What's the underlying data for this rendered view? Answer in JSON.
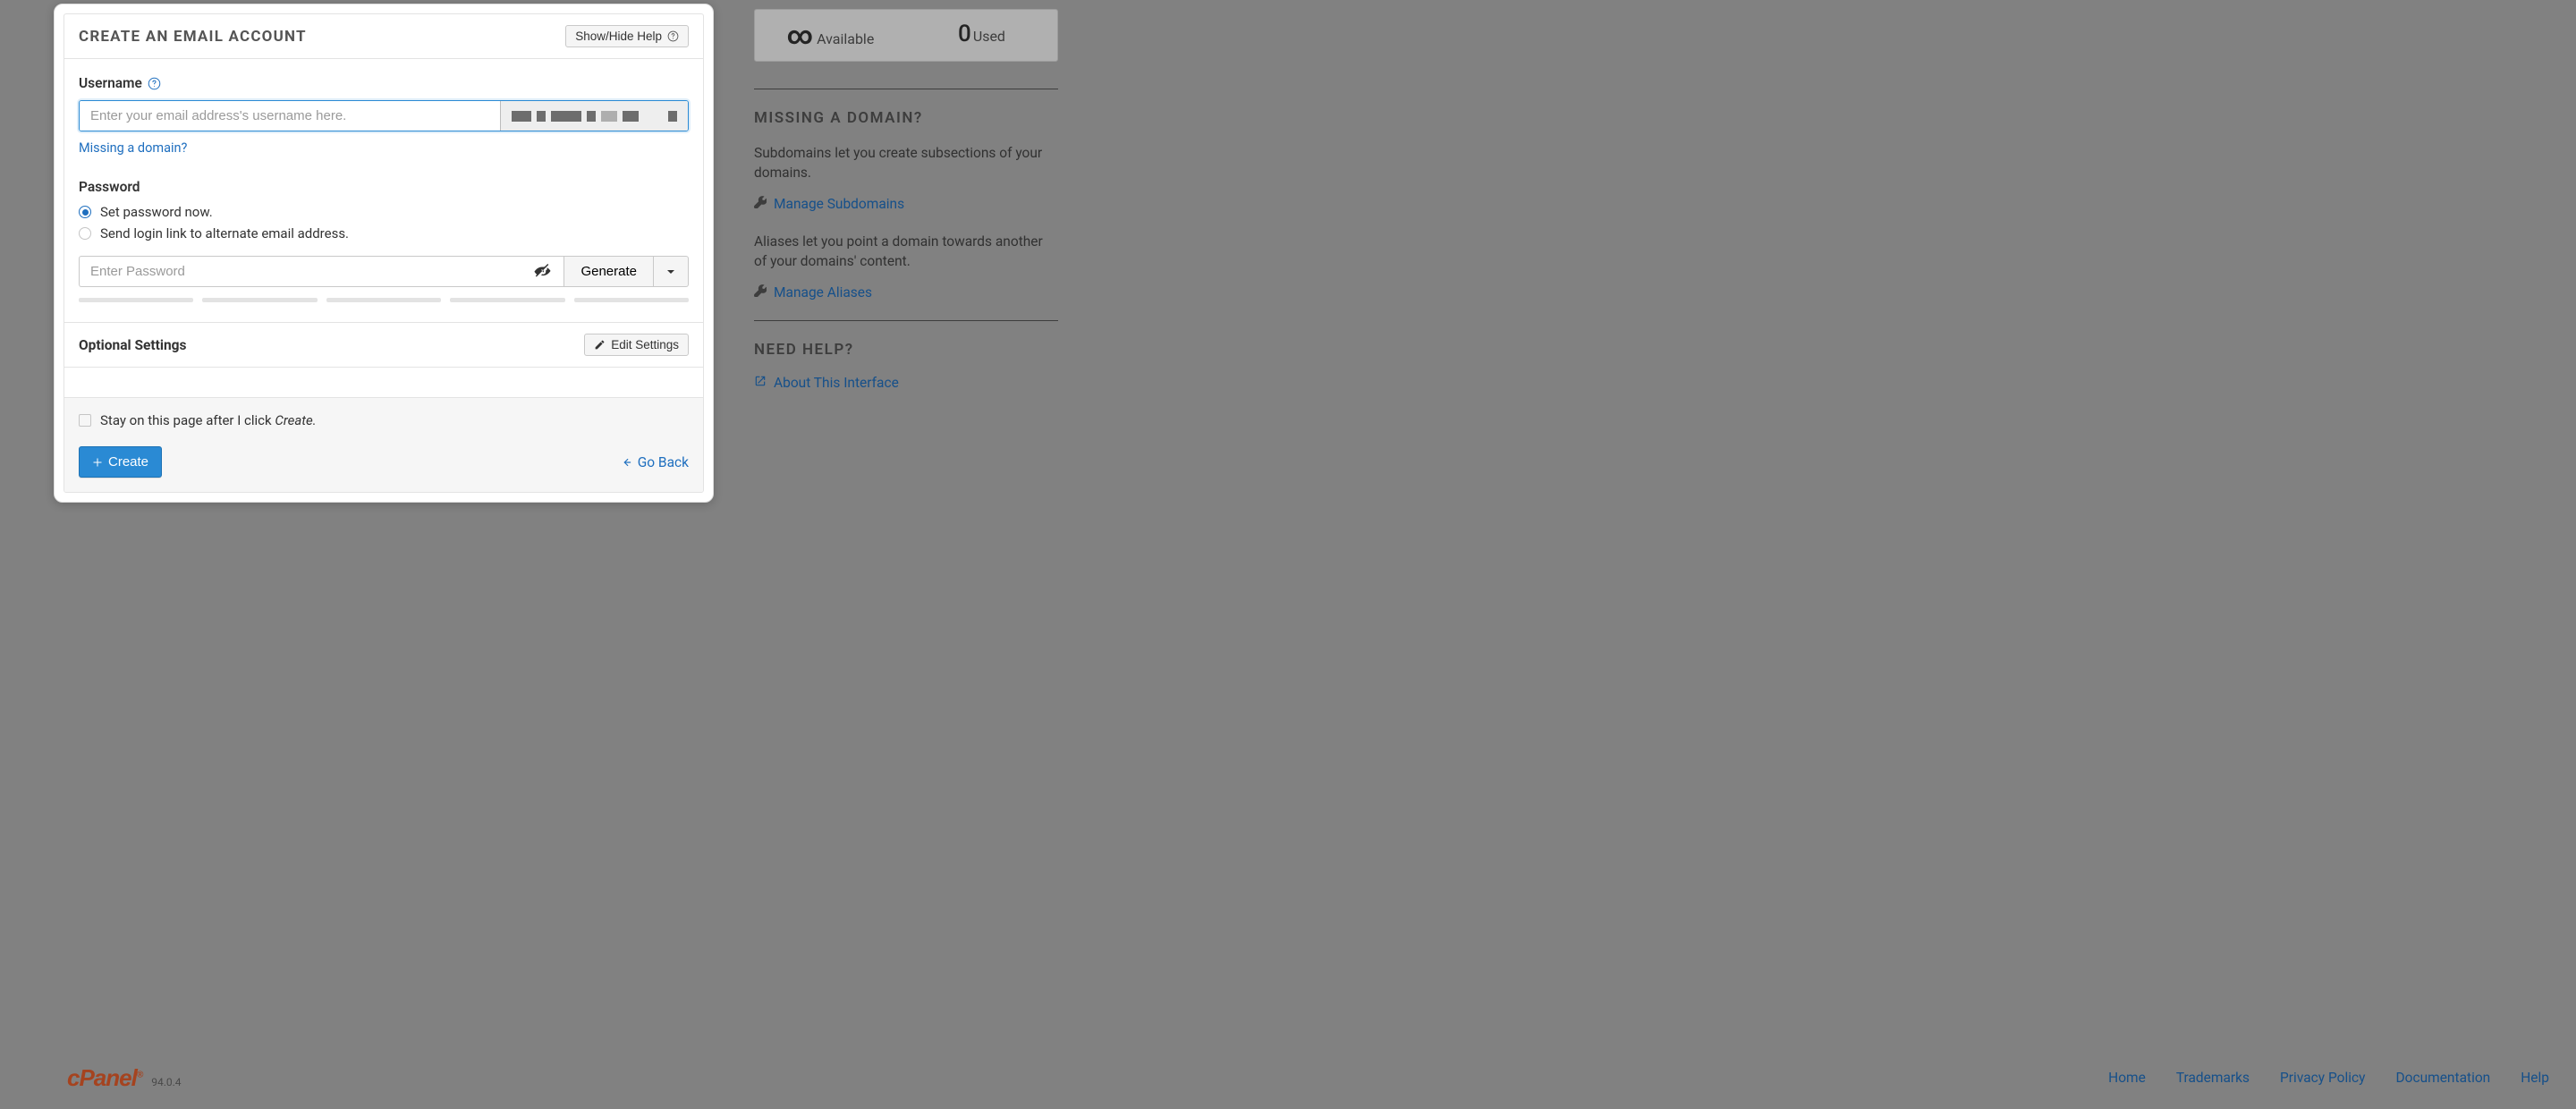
{
  "panel": {
    "title": "Create an Email Account",
    "help_btn": "Show/Hide Help",
    "username_label": "Username",
    "username_placeholder": "Enter your email address's username here.",
    "missing_domain_link": "Missing a domain?",
    "password_label": "Password",
    "radio_set_now": "Set password now.",
    "radio_send_link": "Send login link to alternate email address.",
    "password_placeholder": "Enter Password",
    "generate_btn": "Generate",
    "optional_title": "Optional Settings",
    "edit_settings_btn": "Edit Settings",
    "stay_text_a": "Stay on this page after I click ",
    "stay_text_b": "Create.",
    "create_btn": "Create",
    "go_back": "Go Back"
  },
  "stats": {
    "available_label": "Available",
    "used_num": "0",
    "used_label": "Used"
  },
  "side": {
    "missing_title": "Missing a Domain?",
    "subdomains_p": "Subdomains let you create subsections of your domains.",
    "manage_subdomains": "Manage Subdomains",
    "aliases_p": "Aliases let you point a domain towards another of your domains' content.",
    "manage_aliases": "Manage Aliases",
    "need_help_title": "Need Help?",
    "about_interface": "About This Interface"
  },
  "footer": {
    "brand": "cPanel",
    "version": "94.0.4",
    "links": {
      "home": "Home",
      "trademarks": "Trademarks",
      "privacy": "Privacy Policy",
      "docs": "Documentation",
      "help": "Help"
    }
  }
}
